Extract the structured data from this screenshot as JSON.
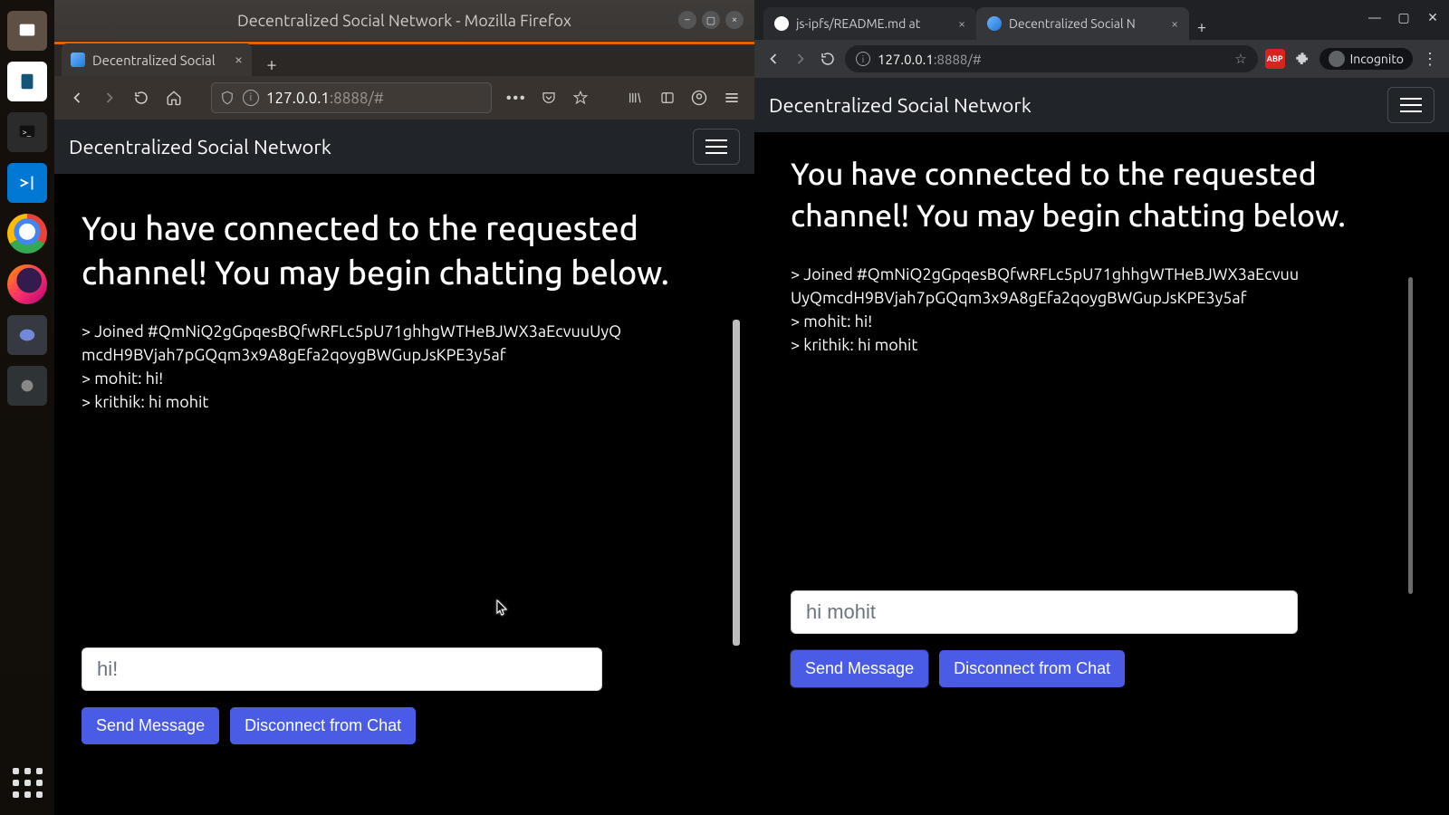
{
  "dock": {
    "items": [
      "files",
      "writer",
      "terminal",
      "vscode",
      "chrome",
      "firefox",
      "discord",
      "tool"
    ],
    "apps_icon": "apps-grid"
  },
  "firefox": {
    "window_title": "Decentralized Social Network - Mozilla Firefox",
    "tab_label": "Decentralized Social",
    "url_host": "127.0.0.1",
    "url_rest": ":8888/#",
    "page": {
      "brand": "Decentralized Social Network",
      "headline": "You have connected to the requested channel! You may begin chatting below.",
      "log": [
        "> Joined #QmNiQ2gGpqesBQfwRFLc5pU71ghhgWTHeBJWX3aEcvuuUyQmcdH9BVjah7pGQqm3x9A8gEfa2qoygBWGupJsKPE3y5af",
        "> mohit: hi!",
        "> krithik: hi mohit"
      ],
      "input_value": "hi!",
      "send_label": "Send Message",
      "disconnect_label": "Disconnect from Chat"
    }
  },
  "chrome": {
    "tabs": [
      {
        "label": "js-ipfs/README.md at",
        "favicon": "github",
        "active": false
      },
      {
        "label": "Decentralized Social N",
        "favicon": "app",
        "active": true
      }
    ],
    "url_host": "127.0.0.1",
    "url_rest": ":8888/#",
    "incognito_label": "Incognito",
    "page": {
      "brand": "Decentralized Social Network",
      "headline": "You have connected to the requested channel! You may begin chatting below.",
      "log": [
        "> Joined #QmNiQ2gGpqesBQfwRFLc5pU71ghhgWTHeBJWX3aEcvuuUyQmcdH9BVjah7pGQqm3x9A8gEfa2qoygBWGupJsKPE3y5af",
        "> mohit: hi!",
        "> krithik: hi mohit"
      ],
      "input_value": "hi mohit",
      "send_label": "Send Message",
      "disconnect_label": "Disconnect from Chat"
    }
  }
}
